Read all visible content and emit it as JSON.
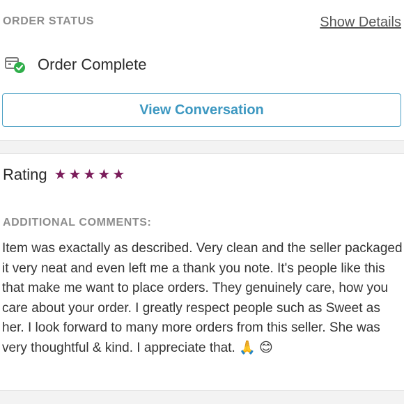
{
  "order": {
    "status_label": "ORDER STATUS",
    "show_details": "Show Details",
    "status_text": "Order Complete",
    "status_icon": "package-check-icon",
    "view_conversation": "View Conversation"
  },
  "rating": {
    "label": "Rating",
    "stars": 5,
    "max_stars": 5,
    "star_color": "#7b1d5b",
    "star_icon": "star-icon"
  },
  "comments": {
    "label": "ADDITIONAL COMMENTS:",
    "text": "Item was exactally as described. Very clean and the seller packaged it very neat and even left me a thank you note. It's people like this that make me want to place orders. They genuinely care, how you care about your order. I greatly respect people such as Sweet as her. I look forward to many more orders from this seller. She was very thoughtful & kind. I appreciate that. 🙏 😊"
  },
  "colors": {
    "accent": "#3d98c1",
    "muted_label": "#8c8c8c",
    "success": "#2fae4a"
  }
}
